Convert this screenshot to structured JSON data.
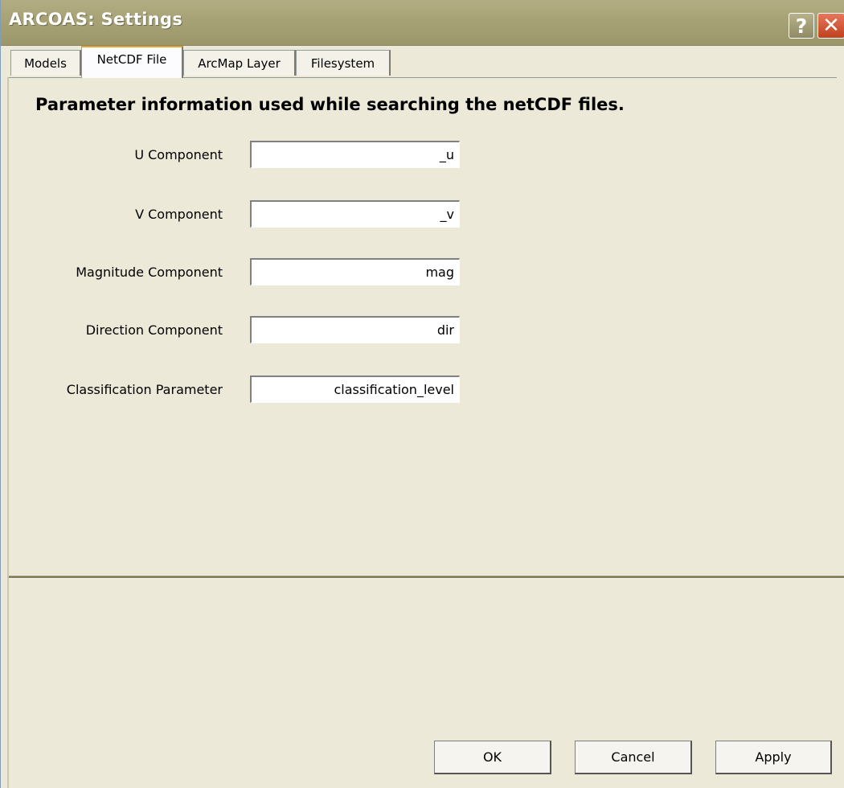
{
  "window": {
    "title": "ARCOAS: Settings",
    "help_symbol": "?",
    "close_symbol": "✕"
  },
  "tabs": [
    {
      "label": "Models",
      "active": false
    },
    {
      "label": "NetCDF File",
      "active": true
    },
    {
      "label": "ArcMap Layer",
      "active": false
    },
    {
      "label": "Filesystem",
      "active": false
    }
  ],
  "panel": {
    "heading": "Parameter information used while searching the netCDF files.",
    "fields": [
      {
        "label": "U Component",
        "value": "_u"
      },
      {
        "label": "V Component",
        "value": "_v"
      },
      {
        "label": "Magnitude Component",
        "value": "mag"
      },
      {
        "label": "Direction Component",
        "value": "dir"
      },
      {
        "label": "Classification Parameter",
        "value": "classification_level"
      }
    ]
  },
  "buttons": {
    "ok": "OK",
    "cancel": "Cancel",
    "apply": "Apply"
  },
  "colors": {
    "titlebar": "#a8a377",
    "background": "#ece9d8",
    "active_tab_accent": "#e4a431",
    "close_button": "#c0411e"
  }
}
